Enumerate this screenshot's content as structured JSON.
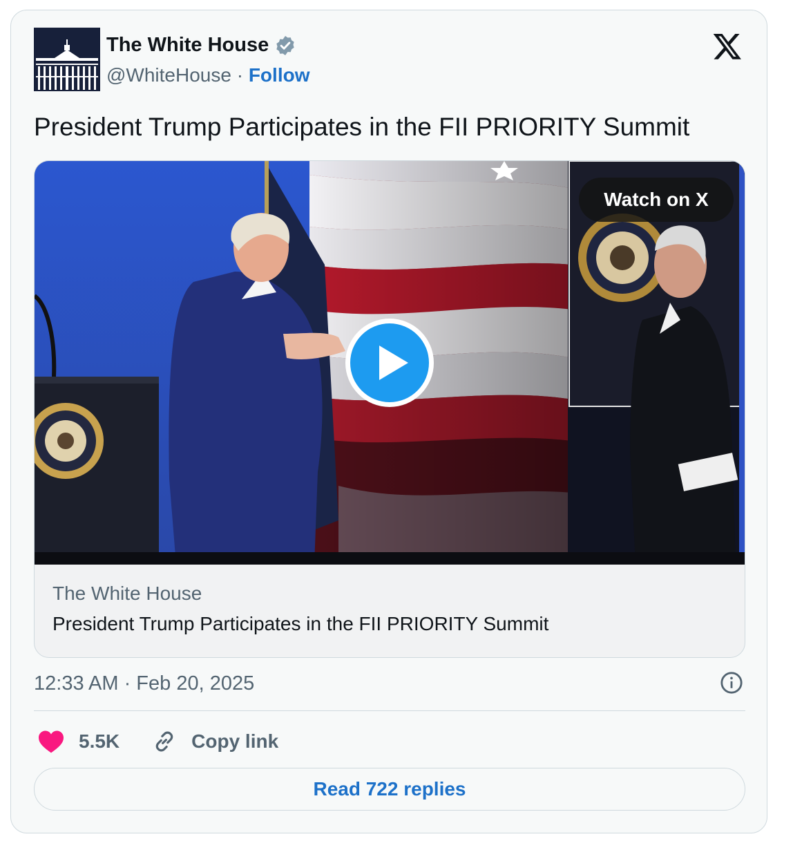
{
  "author": {
    "name": "The White House",
    "handle": "@WhiteHouse",
    "separator": " · ",
    "follow_label": "Follow",
    "avatar_icon": "white-house-building-icon",
    "verified_icon": "verified-badge-icon"
  },
  "brand_icon": "x-logo-icon",
  "tweet": {
    "text": "President Trump Participates in the FII PRIORITY Summit"
  },
  "media": {
    "watch_label": "Watch on X",
    "play_icon": "play-icon",
    "source": "The White House",
    "title": "President Trump Participates in the FII PRIORITY Summit"
  },
  "timestamp": "12:33 AM · Feb 20, 2025",
  "info_icon": "info-icon",
  "actions": {
    "like_count": "5.5K",
    "like_icon": "heart-icon",
    "copy_label": "Copy link",
    "copy_icon": "link-icon"
  },
  "replies_label": "Read 722 replies",
  "colors": {
    "accent": "#1d71c9",
    "like": "#f91880",
    "muted": "#536471",
    "border": "#cfd9de",
    "play_button": "#1d9bf0"
  }
}
